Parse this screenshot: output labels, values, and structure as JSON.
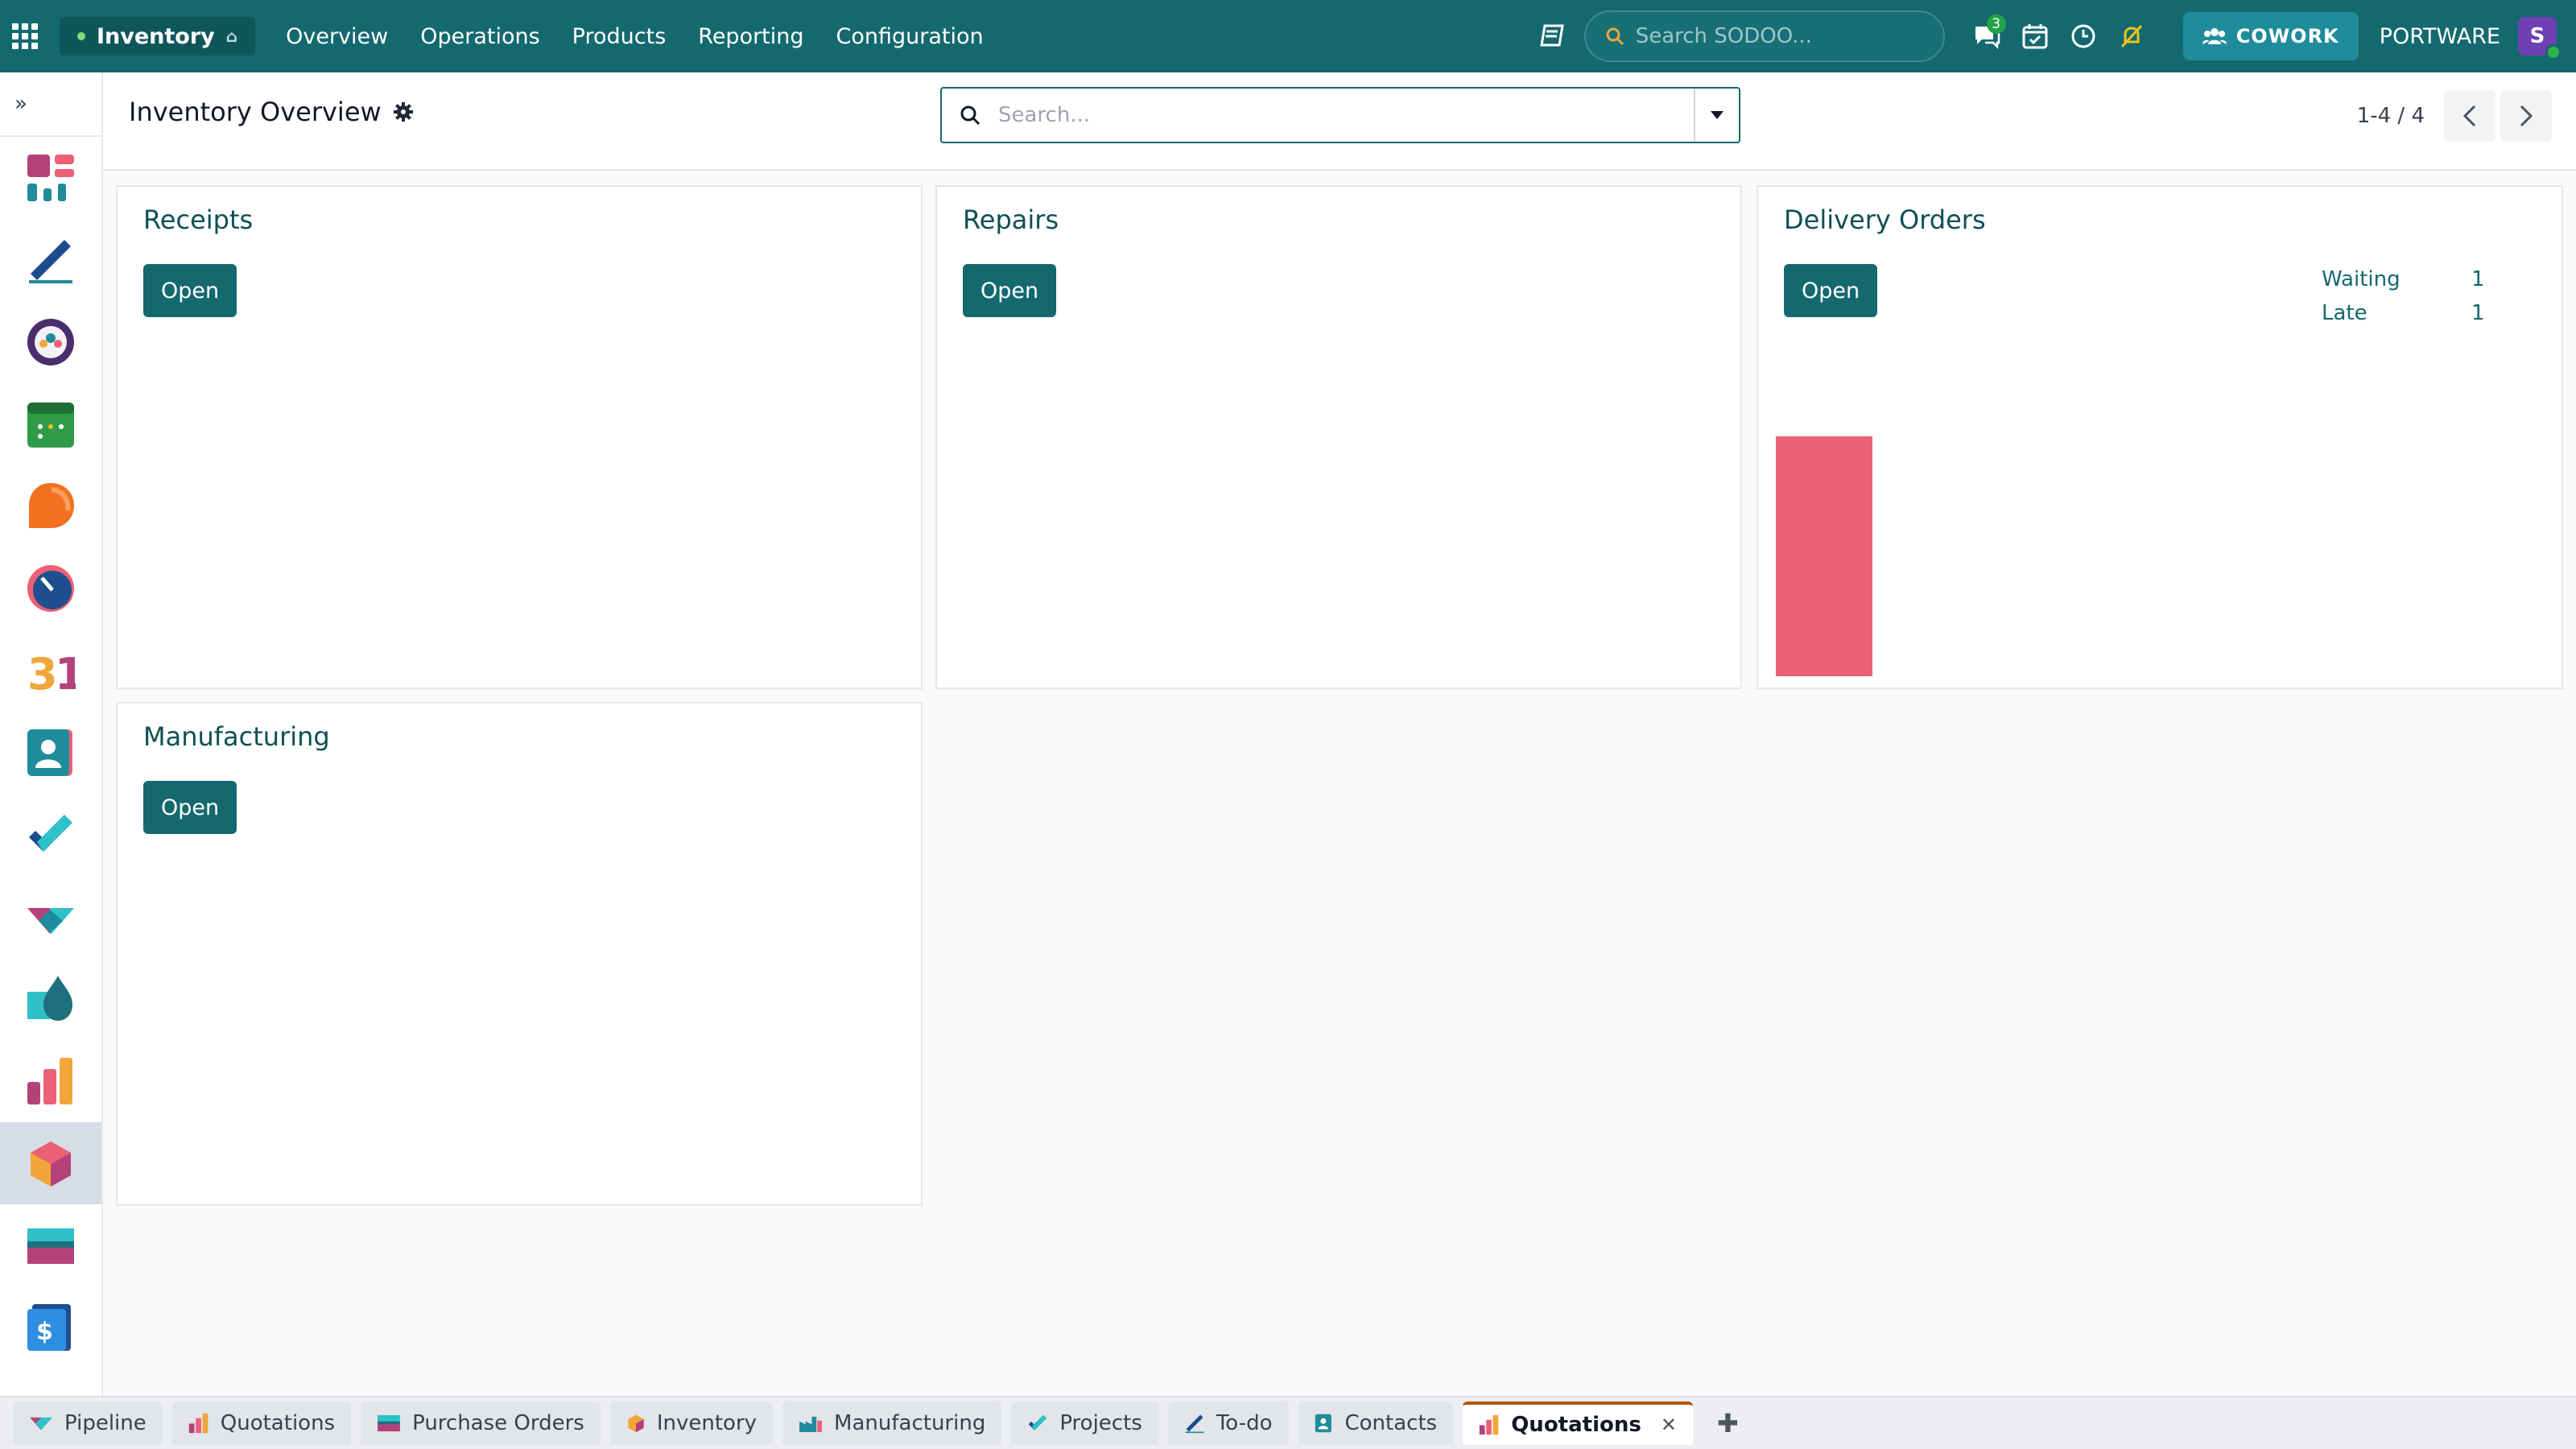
{
  "topbar": {
    "app_name": "Inventory",
    "menu": [
      "Overview",
      "Operations",
      "Products",
      "Reporting",
      "Configuration"
    ],
    "search_placeholder": "Search SODOO...",
    "messages_count": "3",
    "cowork_label": "COWORK",
    "company": "PORTWARE",
    "avatar_letter": "S"
  },
  "control": {
    "title": "Inventory Overview",
    "search_placeholder": "Search...",
    "pager": "1-4 / 4"
  },
  "cards": {
    "receipts": {
      "title": "Receipts",
      "button": "Open"
    },
    "repairs": {
      "title": "Repairs",
      "button": "Open"
    },
    "delivery": {
      "title": "Delivery Orders",
      "button": "Open",
      "stats": [
        {
          "label": "Waiting",
          "value": "1"
        },
        {
          "label": "Late",
          "value": "1"
        }
      ],
      "graph_fill": 0.48
    },
    "manufacturing": {
      "title": "Manufacturing",
      "button": "Open"
    }
  },
  "tabs": {
    "items": [
      "Pipeline",
      "Quotations",
      "Purchase Orders",
      "Inventory",
      "Manufacturing",
      "Projects",
      "To-do",
      "Contacts",
      "Quotations"
    ],
    "active_index": 8
  },
  "colors": {
    "brand": "#14696f",
    "graph_bar": "#ec6075"
  }
}
